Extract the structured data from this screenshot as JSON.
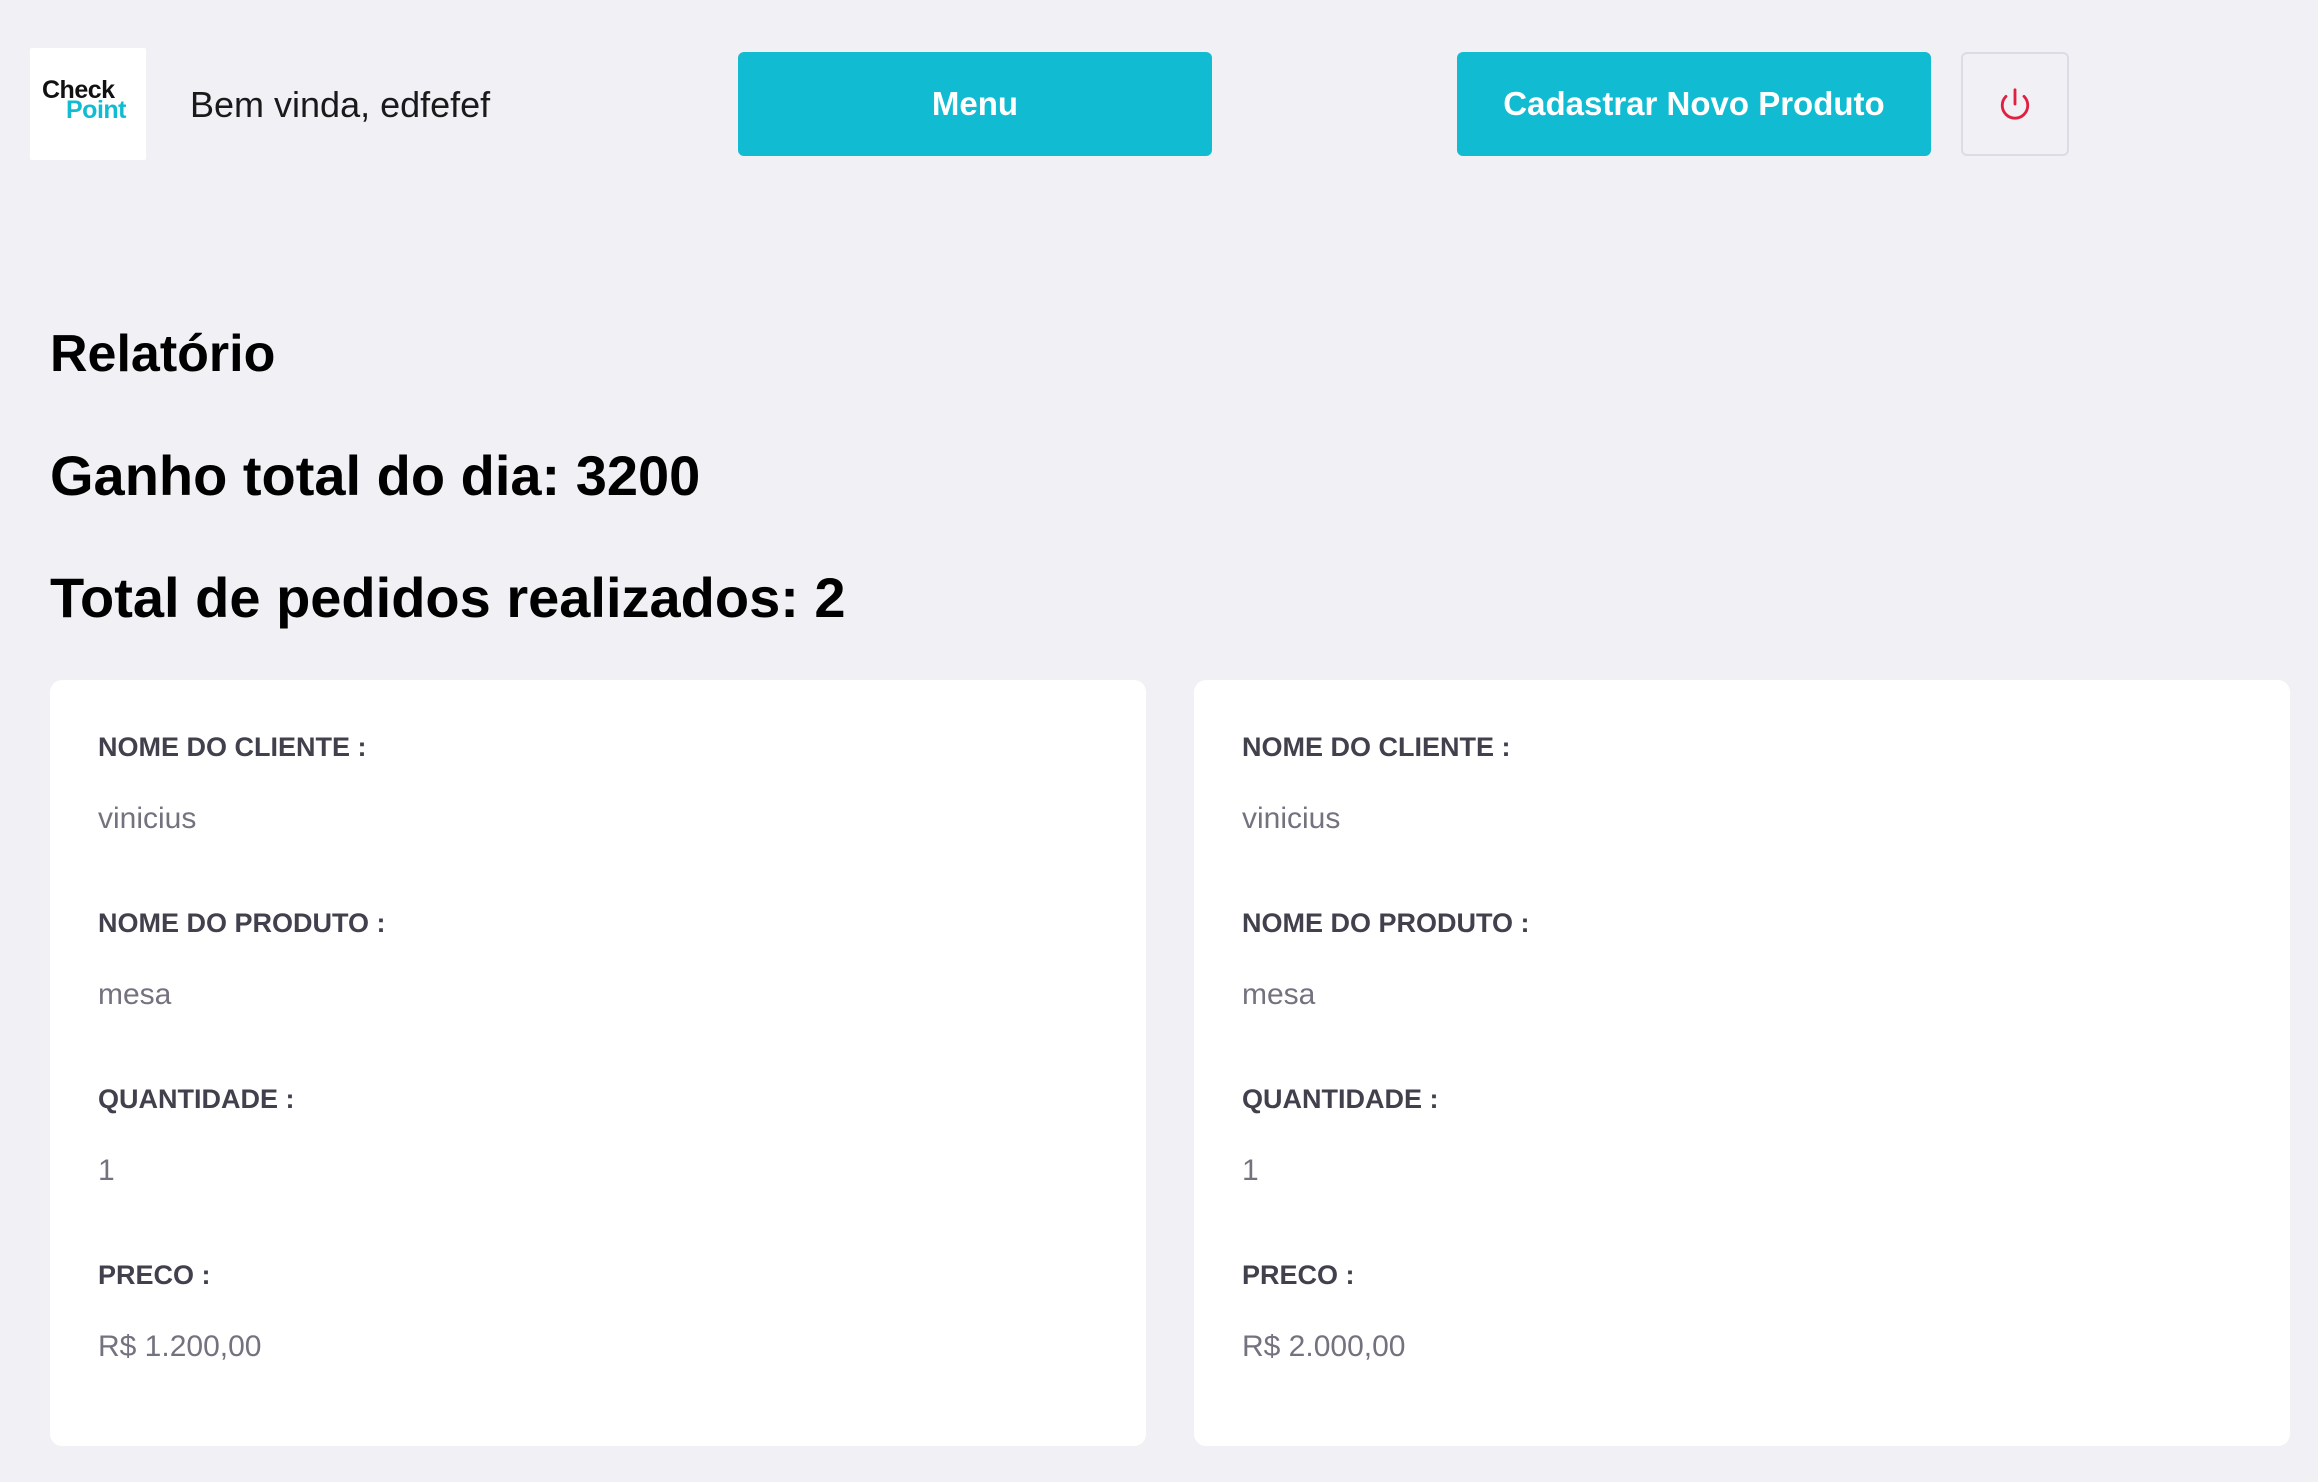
{
  "header": {
    "logo_line1": "Check",
    "logo_line2": "Point",
    "welcome": "Bem vinda, edfefef",
    "menu_label": "Menu",
    "cadastrar_label": "Cadastrar Novo Produto",
    "power_icon": "power-icon"
  },
  "report": {
    "title": "Relatório",
    "ganho": "Ganho total do dia: 3200",
    "total_pedidos": "Total de pedidos realizados: 2"
  },
  "labels": {
    "cliente": "NOME DO CLIENTE :",
    "produto": "NOME DO PRODUTO :",
    "quantidade": "QUANTIDADE :",
    "preco": "PRECO :"
  },
  "orders": [
    {
      "cliente": "vinicius",
      "produto": "mesa",
      "quantidade": "1",
      "preco": "R$ 1.200,00"
    },
    {
      "cliente": "vinicius",
      "produto": "mesa",
      "quantidade": "1",
      "preco": "R$ 2.000,00"
    }
  ],
  "colors": {
    "accent": "#11bcd2",
    "background": "#f0f0f5",
    "power": "#e02041",
    "label": "#41414d",
    "value": "#737380"
  }
}
